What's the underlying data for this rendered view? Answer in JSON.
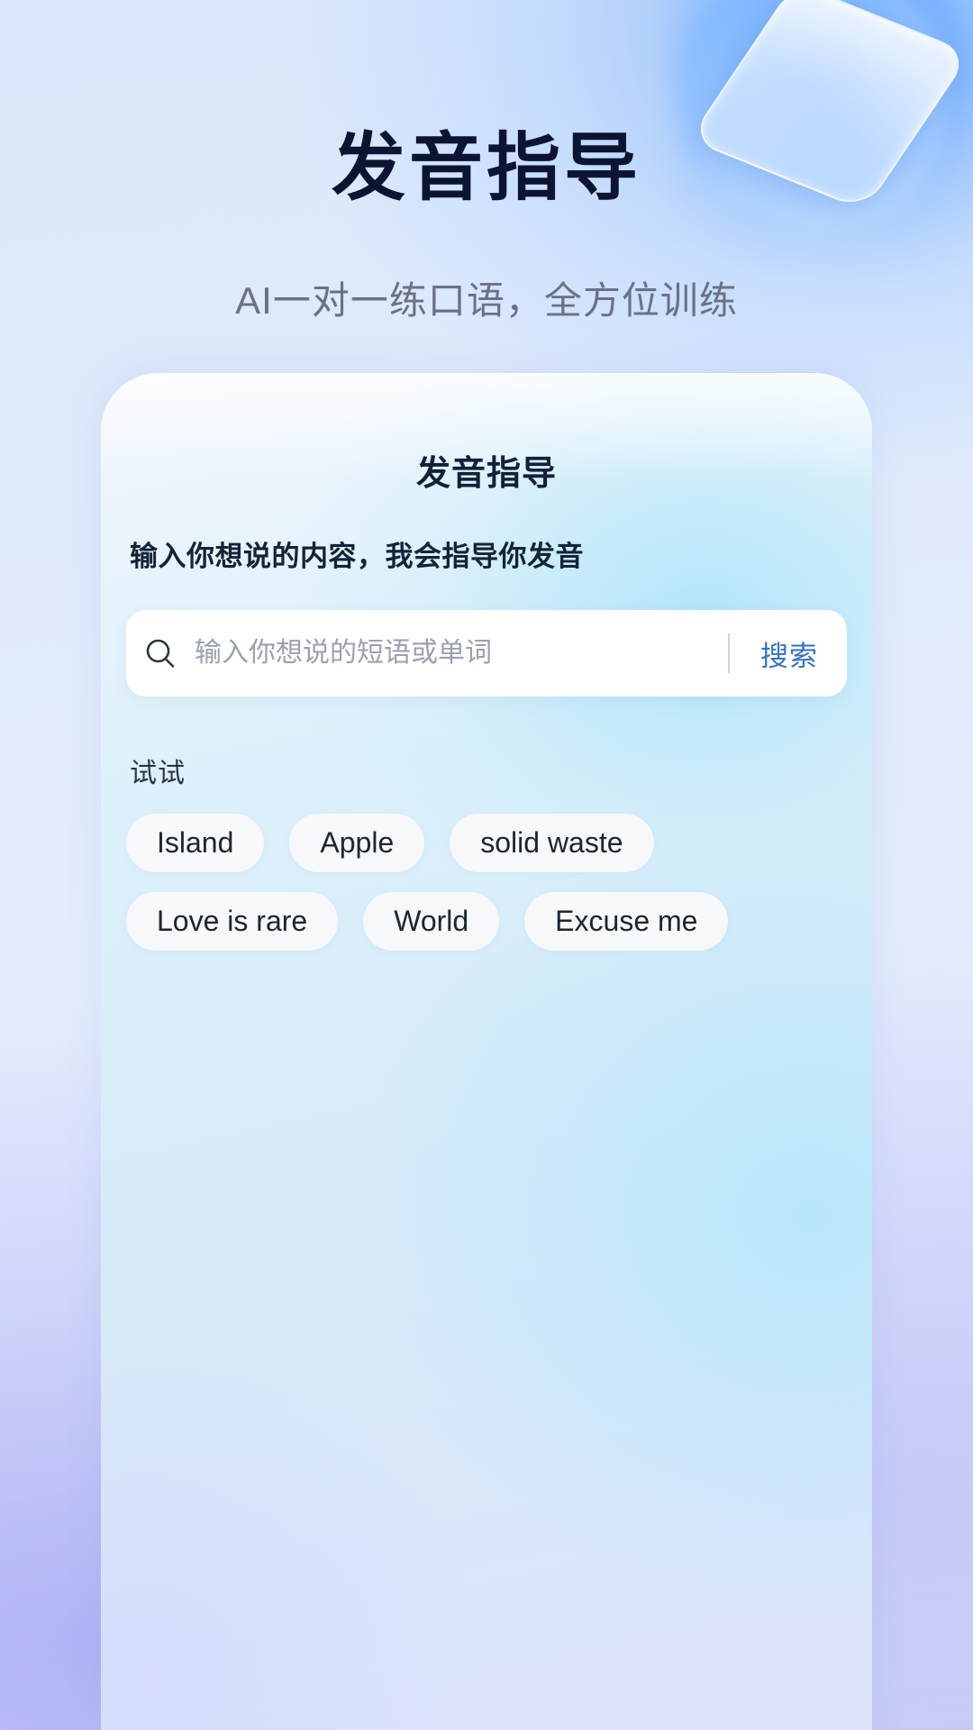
{
  "hero": {
    "title": "发音指导",
    "subtitle": "AI一对一练口语，全方位训练",
    "decoration_icon": "play-triangle-glass-icon",
    "title_color": "#0b1431",
    "subtitle_color": "#6a7186"
  },
  "card": {
    "title": "发音指导",
    "prompt": "输入你想说的内容，我会指导你发音"
  },
  "search": {
    "icon": "search-icon",
    "placeholder": "输入你想说的短语或单词",
    "value": "",
    "button_label": "搜索",
    "button_color": "#3570c4"
  },
  "suggestions": {
    "label": "试试",
    "rows": [
      [
        "Island",
        "Apple",
        "solid waste"
      ],
      [
        "Love is rare",
        "World",
        "Excuse me"
      ]
    ]
  }
}
